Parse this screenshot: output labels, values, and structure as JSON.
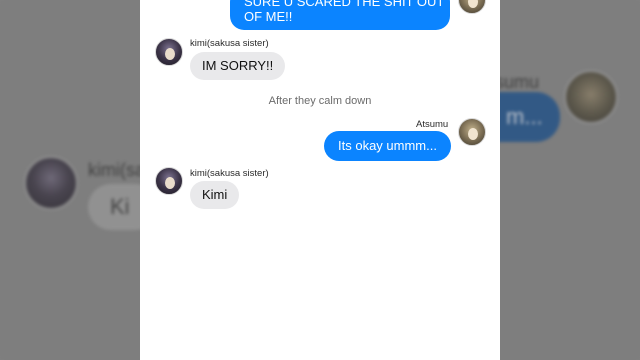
{
  "background": {
    "left_name": "kimi(sak",
    "left_bubble": "Ki",
    "right_name": "Atsumu",
    "right_bubble": "m..."
  },
  "chat": {
    "top_message_line1": "SURE U SCARED THE SHIT OUT",
    "top_message_line2": "OF ME!!",
    "msg1_sender": "kimi(sakusa sister)",
    "msg1_text": "IM SORRY!!",
    "divider": "After they calm down",
    "msg2_sender": "Atsumu",
    "msg2_text": "Its okay ummm...",
    "msg3_sender": "kimi(sakusa sister)",
    "msg3_text": "Kimi"
  },
  "colors": {
    "outgoing_bubble": "#0b84ff",
    "incoming_bubble": "#e9e9eb"
  }
}
